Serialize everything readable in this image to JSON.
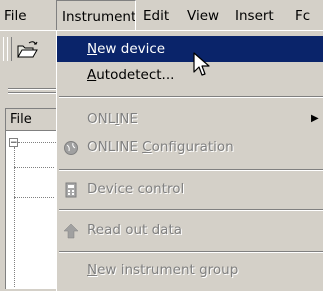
{
  "menubar": {
    "items": [
      {
        "label": "File"
      },
      {
        "label": "Instrument"
      },
      {
        "label": "Edit"
      },
      {
        "label": "View"
      },
      {
        "label": "Insert"
      },
      {
        "label": "Fc"
      }
    ]
  },
  "panel": {
    "header": "File"
  },
  "menu": {
    "new_device": {
      "pre": "",
      "u": "N",
      "post": "ew device"
    },
    "autodetect": {
      "pre": "",
      "u": "A",
      "post": "utodetect..."
    },
    "online": {
      "pre": "ONL",
      "u": "I",
      "post": "NE"
    },
    "online_config": {
      "pre": "ONLINE ",
      "u": "C",
      "post": "onfiguration"
    },
    "device_control": {
      "label": "Device control"
    },
    "read_out": {
      "label": "Read out data"
    },
    "new_group": {
      "pre": "",
      "u": "N",
      "post": "ew instrument group"
    }
  },
  "colors": {
    "highlight": "#0a246a",
    "face": "#d4d0c8",
    "disabled": "#808080"
  },
  "icons": {
    "open": "open-folder-icon",
    "online_config": "globe-icon",
    "device_control": "device-icon",
    "read_out": "arrow-up-icon",
    "cursor": "mouse-pointer-icon",
    "submenu": "submenu-arrow-icon"
  }
}
